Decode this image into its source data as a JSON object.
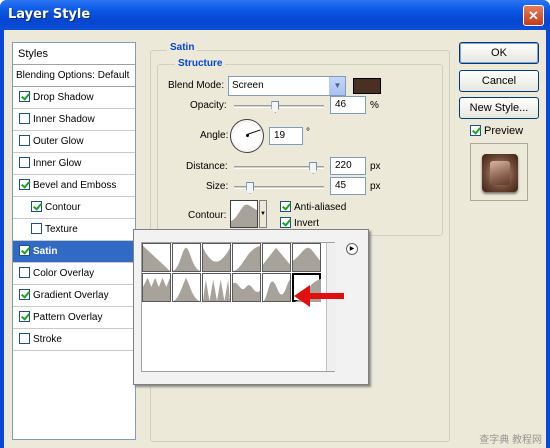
{
  "window": {
    "title": "Layer Style",
    "close_glyph": "✕"
  },
  "styles_panel": {
    "header": "Styles",
    "blending_options": "Blending Options: Default",
    "items": [
      {
        "label": "Drop Shadow",
        "checked": true,
        "indent": false,
        "selected": false
      },
      {
        "label": "Inner Shadow",
        "checked": false,
        "indent": false,
        "selected": false
      },
      {
        "label": "Outer Glow",
        "checked": false,
        "indent": false,
        "selected": false
      },
      {
        "label": "Inner Glow",
        "checked": false,
        "indent": false,
        "selected": false
      },
      {
        "label": "Bevel and Emboss",
        "checked": true,
        "indent": false,
        "selected": false
      },
      {
        "label": "Contour",
        "checked": true,
        "indent": true,
        "selected": false
      },
      {
        "label": "Texture",
        "checked": false,
        "indent": true,
        "selected": false
      },
      {
        "label": "Satin",
        "checked": true,
        "indent": false,
        "selected": true
      },
      {
        "label": "Color Overlay",
        "checked": false,
        "indent": false,
        "selected": false
      },
      {
        "label": "Gradient Overlay",
        "checked": true,
        "indent": false,
        "selected": false
      },
      {
        "label": "Pattern Overlay",
        "checked": true,
        "indent": false,
        "selected": false
      },
      {
        "label": "Stroke",
        "checked": false,
        "indent": false,
        "selected": false
      }
    ]
  },
  "satin": {
    "section_title": "Satin",
    "structure_title": "Structure",
    "blend_mode_label": "Blend Mode:",
    "blend_mode_value": "Screen",
    "blend_color": "#4a3023",
    "opacity_label": "Opacity:",
    "opacity_value": "46",
    "opacity_unit": "%",
    "angle_label": "Angle:",
    "angle_value": "19",
    "angle_unit": "°",
    "distance_label": "Distance:",
    "distance_value": "220",
    "distance_unit": "px",
    "size_label": "Size:",
    "size_value": "45",
    "size_unit": "px",
    "contour_label": "Contour:",
    "anti_aliased_label": "Anti-aliased",
    "anti_aliased_checked": true,
    "invert_label": "Invert",
    "invert_checked": true
  },
  "buttons": {
    "ok": "OK",
    "cancel": "Cancel",
    "new_style": "New Style...",
    "preview_label": "Preview",
    "preview_checked": true
  },
  "contour_picker": {
    "menu_glyph": "▶",
    "selected_index": 11,
    "tile_count": 12
  },
  "watermark": "查字典 教程网"
}
